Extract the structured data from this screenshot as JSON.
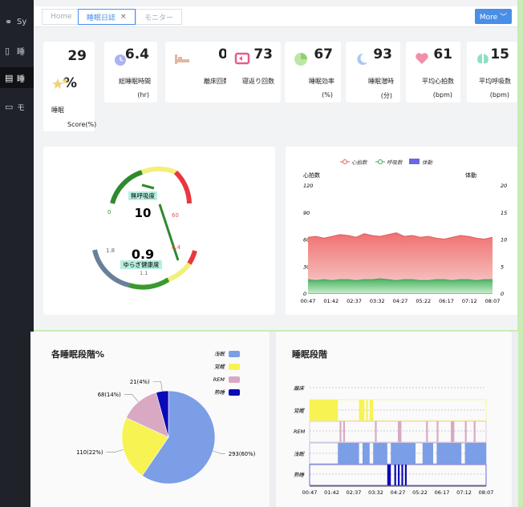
{
  "sidebar": {
    "items": [
      {
        "label": "Sy",
        "icon": "sensor-icon"
      },
      {
        "label": "睡",
        "icon": "document-icon"
      },
      {
        "label": "睡",
        "icon": "report-icon"
      },
      {
        "label": "モ",
        "icon": "monitor-icon"
      }
    ]
  },
  "tabs": [
    {
      "label": "Home"
    },
    {
      "label": "睡眠日誌",
      "close": "×"
    },
    {
      "label": "モニター"
    }
  ],
  "more_label": "More ﹀",
  "stats": [
    {
      "value": "29",
      "value2": "%",
      "label": "睡眠",
      "unit": "Score(%)",
      "icon": "stars-icon"
    },
    {
      "value": "6.4",
      "label": "総睡眠時間",
      "unit": "(hr)",
      "icon": "alarm-clock-icon"
    },
    {
      "value": "0",
      "label": "離床回数",
      "unit": "",
      "icon": "bed-icon"
    },
    {
      "value": "73",
      "label": "寝返り回数",
      "unit": "",
      "icon": "turnover-icon"
    },
    {
      "value": "67",
      "label": "睡眠効率",
      "unit": "(%)",
      "icon": "pie-icon"
    },
    {
      "value": "93",
      "label": "睡眠潜時",
      "unit": "(分)",
      "icon": "moon-icon"
    },
    {
      "value": "61",
      "label": "平均心拍数",
      "unit": "(bpm)",
      "icon": "heart-icon"
    },
    {
      "value": "15",
      "label": "平均呼吸数",
      "unit": "(bpm)",
      "icon": "lungs-icon"
    }
  ],
  "gauge": {
    "apnea_label": "無呼吸度",
    "apnea_value": "10",
    "apnea_min": "0",
    "apnea_max": "60",
    "fluct_label": "ゆらぎ健康度",
    "fluct_value": "0.9",
    "fluct_low": "1.8",
    "fluct_high": "0.4",
    "fluct_mid": "1.1"
  },
  "vitals_chart": {
    "legend": [
      "心拍数",
      "呼吸数",
      "体動"
    ],
    "left_axis_title": "心拍数",
    "right_axis_title": "体動",
    "left_ticks": [
      "120",
      "90",
      "60",
      "30",
      "0"
    ],
    "right_ticks": [
      "20",
      "15",
      "10",
      "5",
      "0"
    ],
    "x_ticks": [
      "00:47",
      "01:42",
      "02:37",
      "03:32",
      "04:27",
      "05:22",
      "06:17",
      "07:12",
      "08:07"
    ]
  },
  "stage_pct": {
    "title": "各睡眠段階%",
    "legend": [
      "浅眠",
      "覚醒",
      "REM",
      "熟睡"
    ],
    "labels": [
      "21(4%)",
      "68(14%)",
      "110(22%)",
      "293(60%)"
    ]
  },
  "stages": {
    "title": "睡眠段階",
    "rows": [
      "離床",
      "覚醒",
      "REM",
      "浅眠",
      "熟睡"
    ],
    "x_ticks": [
      "00:47",
      "01:42",
      "02:37",
      "03:32",
      "04:27",
      "05:22",
      "06:17",
      "07:12",
      "08:07"
    ]
  },
  "chart_data": [
    {
      "type": "line",
      "title": "",
      "series": [
        {
          "name": "心拍数",
          "values": [
            62,
            63,
            61,
            63,
            65,
            64,
            62,
            66,
            64,
            63,
            65,
            67,
            63,
            64,
            62,
            63,
            61,
            60,
            62,
            64,
            63,
            61,
            60,
            62
          ]
        },
        {
          "name": "呼吸数",
          "values": [
            15,
            14,
            15,
            14,
            15,
            15,
            14,
            15,
            15,
            16,
            15,
            14,
            15,
            15,
            14,
            14,
            15,
            15,
            14,
            15,
            15,
            14,
            15,
            15
          ]
        }
      ],
      "x": [
        "00:47",
        "01:42",
        "02:37",
        "03:32",
        "04:27",
        "05:22",
        "06:17",
        "07:12",
        "08:07"
      ],
      "ylim": [
        0,
        120
      ],
      "y2lim": [
        0,
        20
      ]
    },
    {
      "type": "pie",
      "title": "各睡眠段階%",
      "categories": [
        "浅眠",
        "覚醒",
        "REM",
        "熟睡"
      ],
      "values": [
        293,
        110,
        68,
        21
      ],
      "colors": [
        "#7b9ee6",
        "#f7f352",
        "#d9a9c4",
        "#0a0ab8"
      ]
    }
  ],
  "colors": {
    "accent": "#4a8fe6",
    "heart": "#e05d5d",
    "resp": "#3aa55a"
  }
}
